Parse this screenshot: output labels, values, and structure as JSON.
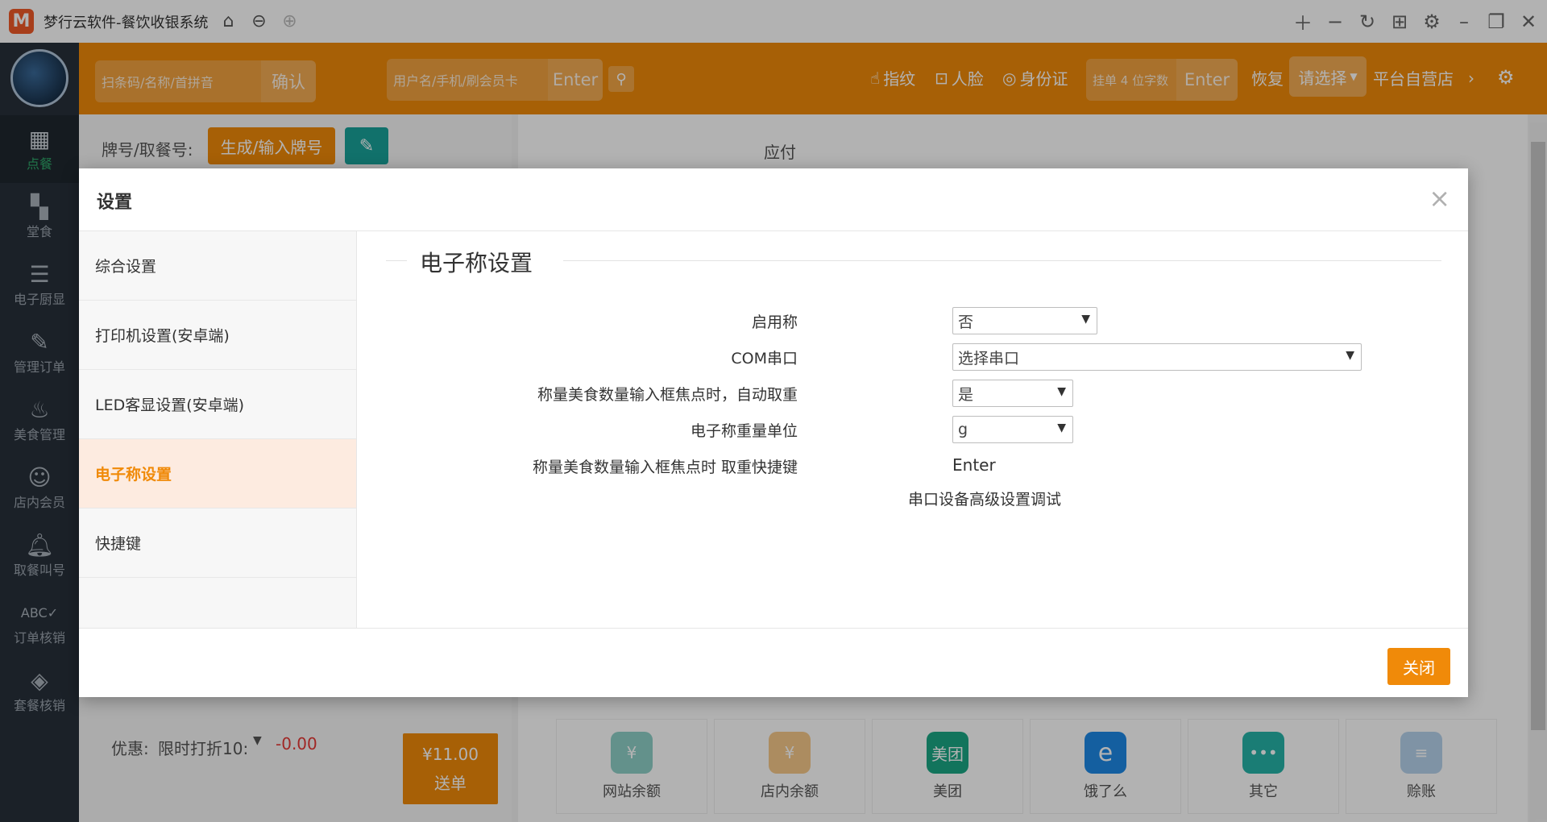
{
  "app": {
    "title": "梦行云软件-餐饮收银系统",
    "logo_letter": "M"
  },
  "header": {
    "scan_placeholder": "扫条码/名称/首拼音",
    "confirm_label": "确认",
    "member_placeholder": "用户名/手机/刷会员卡",
    "enter_label": "Enter",
    "fingerprint_label": "指纹",
    "face_label": "人脸",
    "idcard_label": "身份证",
    "hang_placeholder": "挂单 4 位字数",
    "hang_enter_label": "Enter",
    "restore_label": "恢复",
    "select_label": "请选择",
    "store_label": "平台自营店"
  },
  "sidebar": {
    "items": [
      {
        "label": "点餐",
        "icon": "calculator-icon"
      },
      {
        "label": "堂食",
        "icon": "grid-icon"
      },
      {
        "label": "电子厨显",
        "icon": "list-icon"
      },
      {
        "label": "管理订单",
        "icon": "orders-icon"
      },
      {
        "label": "美食管理",
        "icon": "food-icon"
      },
      {
        "label": "店内会员",
        "icon": "member-icon"
      },
      {
        "label": "取餐叫号",
        "icon": "bell-icon"
      },
      {
        "label": "订单核销",
        "icon": "abc-check-icon"
      },
      {
        "label": "套餐核销",
        "icon": "package-icon"
      }
    ]
  },
  "background": {
    "tag_label": "牌号/取餐号:",
    "generate_label": "生成/输入牌号",
    "payable_label": "应付",
    "discount_label": "优惠:",
    "discount_select": "限时打折10:",
    "discount_value": "-0.00",
    "total_price": "¥11.00",
    "send_label": "送单",
    "pay_methods": [
      {
        "label": "网站余额",
        "color": "#8fd0c8",
        "icon_text": "¥"
      },
      {
        "label": "店内余额",
        "color": "#f6c98a",
        "icon_text": "¥"
      },
      {
        "label": "美团",
        "color": "#1ba784",
        "icon_text": "美团"
      },
      {
        "label": "饿了么",
        "color": "#1e88e5",
        "icon_text": "e"
      },
      {
        "label": "其它",
        "color": "#26b3a8",
        "icon_text": "•••"
      },
      {
        "label": "赊账",
        "color": "#b7d3ec",
        "icon_text": "≡"
      }
    ]
  },
  "dialog": {
    "title": "设置",
    "close_symbol": "×",
    "tabs": [
      {
        "label": "综合设置"
      },
      {
        "label": "打印机设置(安卓端)"
      },
      {
        "label": "LED客显设置(安卓端)"
      },
      {
        "label": "电子称设置"
      },
      {
        "label": "快捷键"
      }
    ],
    "section_title": "电子称设置",
    "fields": {
      "enable": {
        "label": "启用称",
        "value": "否"
      },
      "com": {
        "label": "COM串口",
        "value": "选择串口"
      },
      "auto_weigh": {
        "label": "称量美食数量输入框焦点时，自动取重",
        "value": "是"
      },
      "unit": {
        "label": "电子称重量单位",
        "value": "g"
      },
      "hotkey": {
        "label": "称量美食数量输入框焦点时 取重快捷键",
        "value": "Enter"
      },
      "advanced": {
        "label": "串口设备高级设置调试"
      }
    },
    "footer_close": "关闭"
  }
}
